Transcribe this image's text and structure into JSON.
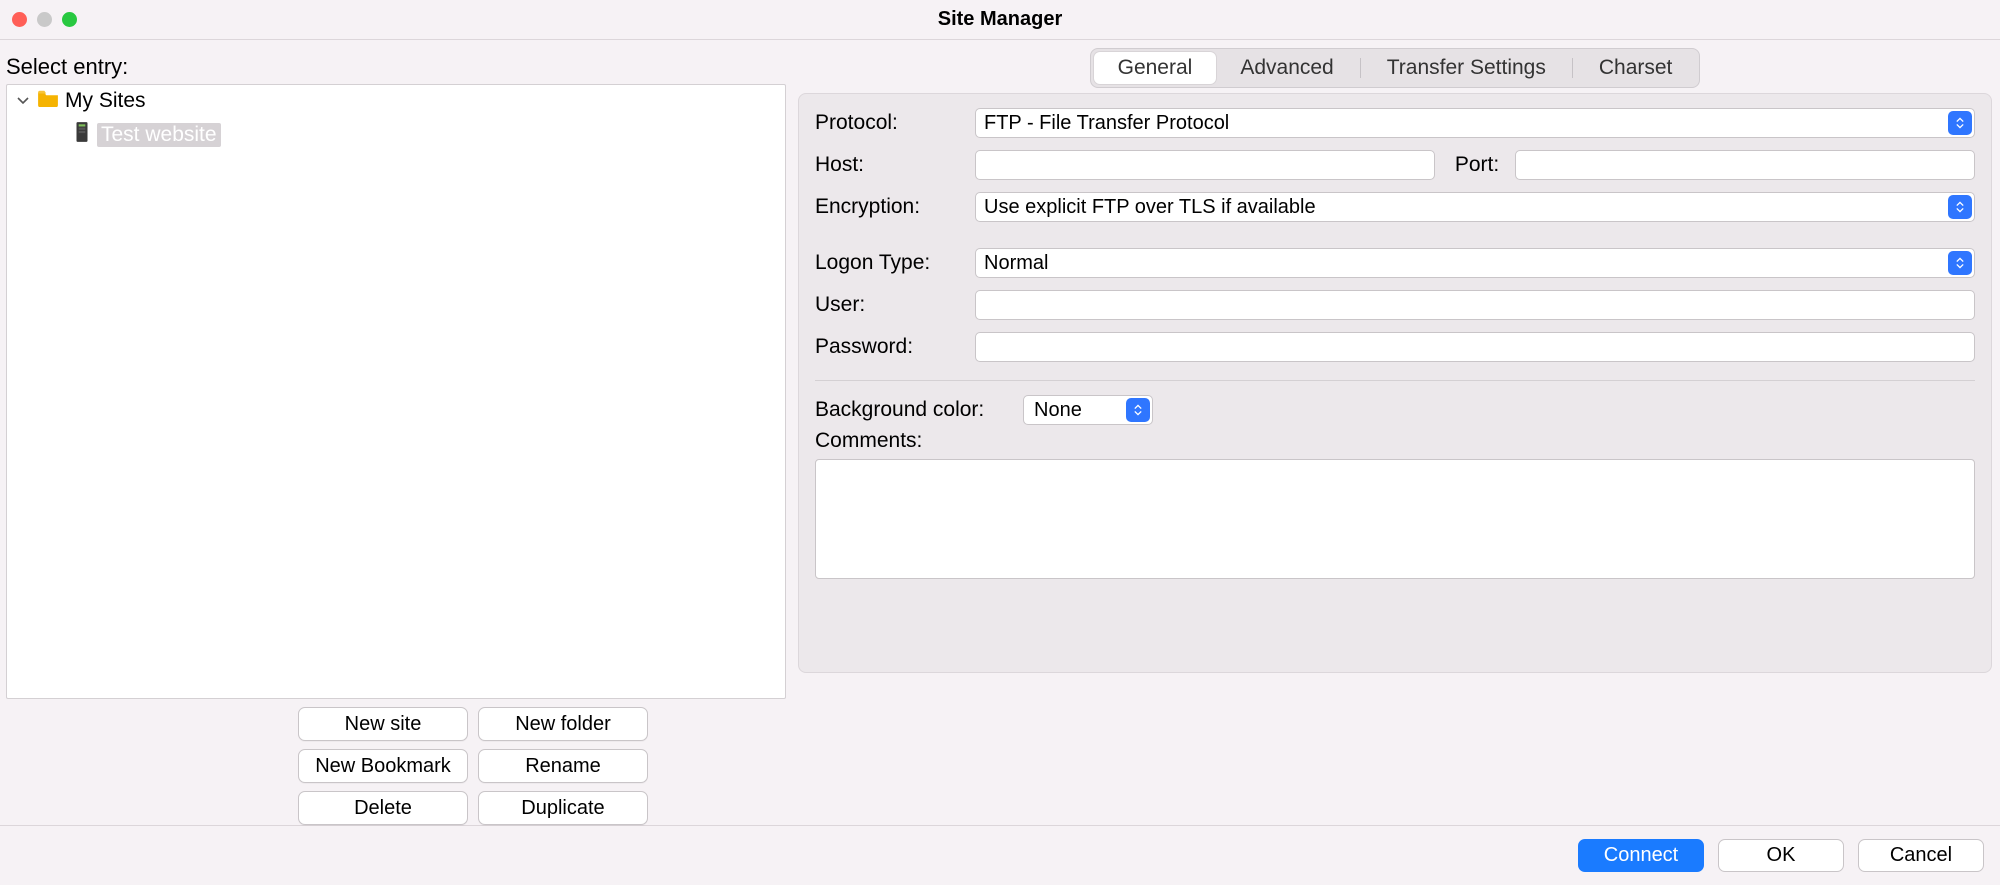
{
  "window": {
    "title": "Site Manager"
  },
  "left": {
    "select_label": "Select entry:",
    "folder_label": "My Sites",
    "site_label": "Test website",
    "buttons": {
      "new_site": "New site",
      "new_folder": "New folder",
      "new_bookmark": "New Bookmark",
      "rename": "Rename",
      "delete": "Delete",
      "duplicate": "Duplicate"
    }
  },
  "tabs": {
    "general": "General",
    "advanced": "Advanced",
    "transfer": "Transfer Settings",
    "charset": "Charset"
  },
  "form": {
    "protocol_label": "Protocol:",
    "protocol_value": "FTP - File Transfer Protocol",
    "host_label": "Host:",
    "host_value": "",
    "port_label": "Port:",
    "port_value": "",
    "encryption_label": "Encryption:",
    "encryption_value": "Use explicit FTP over TLS if available",
    "logon_label": "Logon Type:",
    "logon_value": "Normal",
    "user_label": "User:",
    "user_value": "",
    "password_label": "Password:",
    "password_value": "",
    "bgcolor_label": "Background color:",
    "bgcolor_value": "None",
    "comments_label": "Comments:",
    "comments_value": ""
  },
  "footer": {
    "connect": "Connect",
    "ok": "OK",
    "cancel": "Cancel"
  }
}
